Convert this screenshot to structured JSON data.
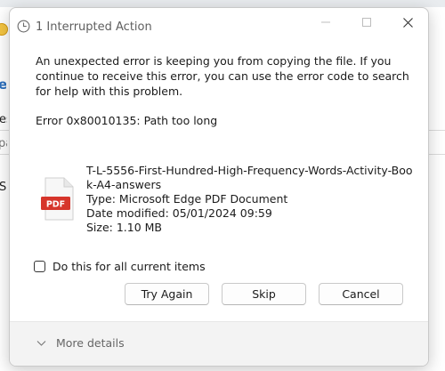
{
  "background": {
    "frag_el": "el",
    "frag_es": "es",
    "frag_pa": "pa",
    "frag_s": "S"
  },
  "dialog": {
    "title": "1 Interrupted Action",
    "message": "An unexpected error is keeping you from copying the file. If you continue to receive this error, you can use the error code to search for help with this problem.",
    "error": "Error 0x80010135: Path too long",
    "file": {
      "icon_label": "PDF",
      "name": "T-L-5556-First-Hundred-High-Frequency-Words-Activity-Book-A4-answers",
      "type": "Type: Microsoft Edge PDF Document",
      "date_modified": "Date modified: 05/01/2024 09:59",
      "size": "Size: 1.10 MB"
    },
    "checkbox": {
      "label": "Do this for all current items",
      "checked": false
    },
    "buttons": {
      "try_again": "Try Again",
      "skip": "Skip",
      "cancel": "Cancel"
    },
    "more_details": "More details"
  },
  "colors": {
    "pdf_red": "#d6352b",
    "accent_blue": "#2a6ebd"
  }
}
